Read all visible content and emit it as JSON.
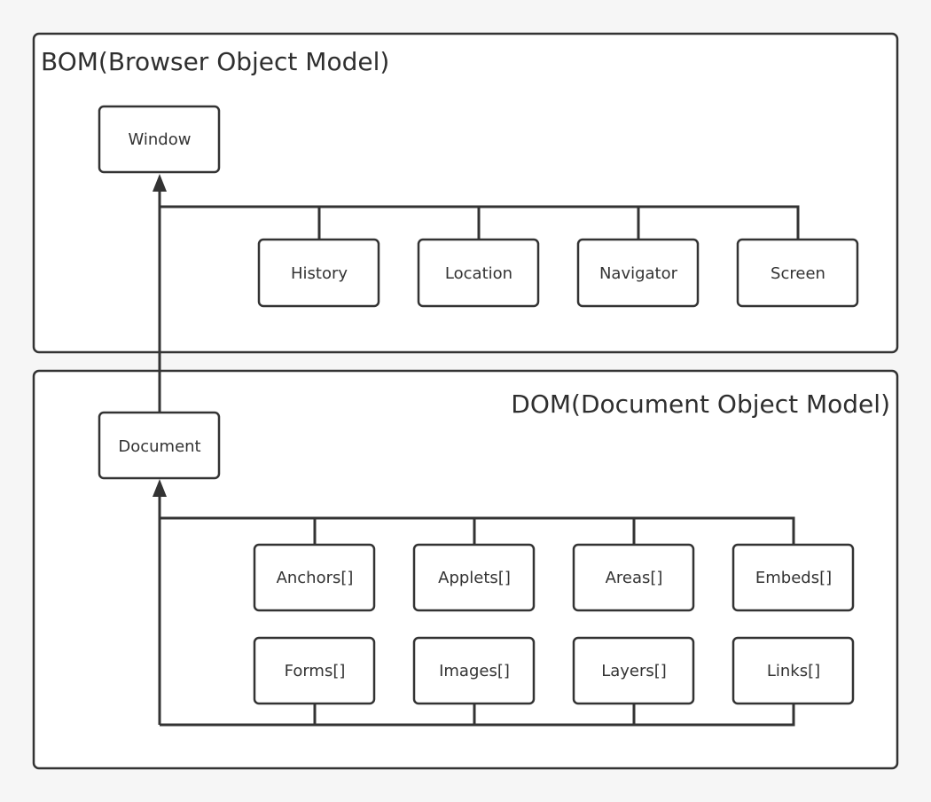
{
  "diagram": {
    "type": "hierarchy",
    "colors": {
      "stroke": "#333333",
      "background": "#f6f6f6",
      "fill": "#ffffff",
      "text": "#333333"
    },
    "groups": [
      {
        "id": "bom",
        "title": "BOM(Browser Object Model)",
        "title_align": "left",
        "root": "Window",
        "children": [
          "History",
          "Location",
          "Navigator",
          "Screen"
        ]
      },
      {
        "id": "dom",
        "title": "DOM(Document Object Model)",
        "title_align": "right",
        "root": "Document",
        "children_rows": [
          [
            "Anchors[]",
            "Applets[]",
            "Areas[]",
            "Embeds[]"
          ],
          [
            "Forms[]",
            "Images[]",
            "Layers[]",
            "Links[]"
          ]
        ]
      }
    ],
    "edges": [
      {
        "from": "Document",
        "to": "Window",
        "arrow": "to"
      },
      {
        "from": "BOM children",
        "to": "Window",
        "arrow": "to"
      },
      {
        "from": "DOM children",
        "to": "Document",
        "arrow": "to"
      }
    ]
  }
}
